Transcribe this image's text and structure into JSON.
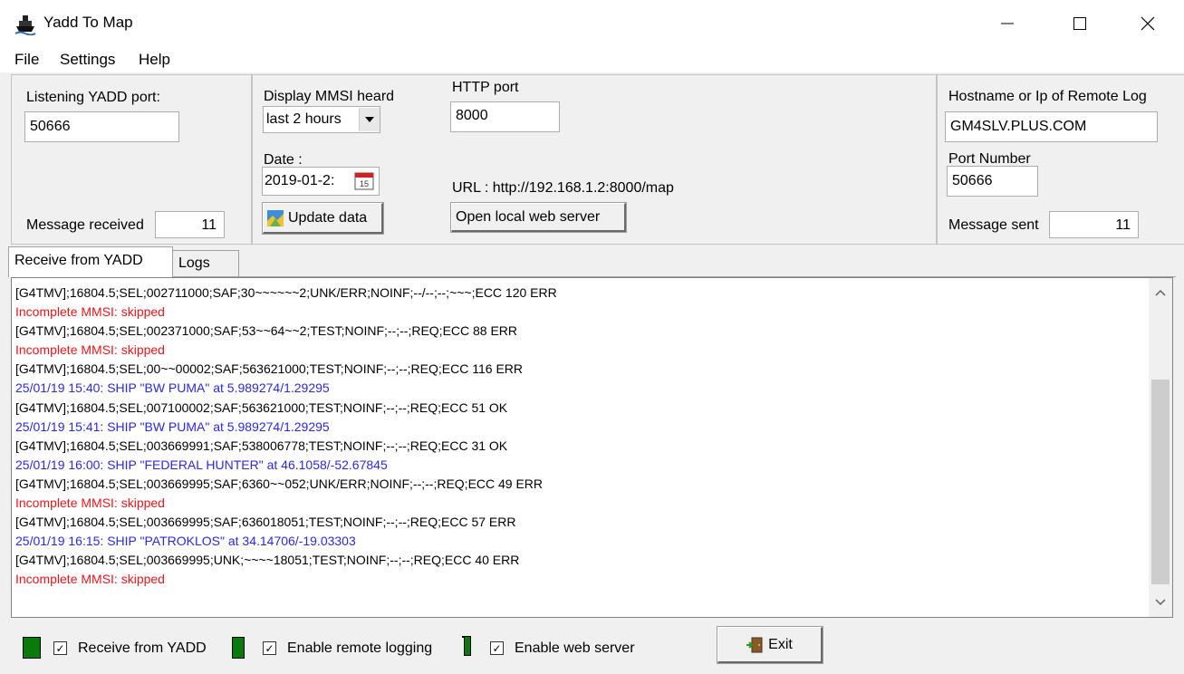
{
  "window": {
    "title": "Yadd To Map"
  },
  "menu": {
    "file": "File",
    "settings": "Settings",
    "help": "Help"
  },
  "yadd": {
    "port_label": "Listening YADD port:",
    "port_value": "50666",
    "msg_label": "Message received",
    "msg_count": "11"
  },
  "display": {
    "mmsi_label": "Display MMSI heard",
    "mmsi_selected": "last 2 hours",
    "date_label": "Date :",
    "date_value": "2019-01-2:",
    "update_label": "Update data"
  },
  "http": {
    "port_label": "HTTP port",
    "port_value": "8000",
    "url_text": "URL : http://192.168.1.2:8000/map",
    "open_label": "Open local web server"
  },
  "remote": {
    "host_label": "Hostname or Ip of Remote Log",
    "host_value": "GM4SLV.PLUS.COM",
    "port_label": "Port Number",
    "port_value": "50666",
    "sent_label": "Message sent",
    "sent_count": "11"
  },
  "tabs": {
    "receive": "Receive from YADD",
    "logs": "Logs"
  },
  "log": [
    {
      "text": "[G4TMV];16804.5;SEL;002711000;SAF;30~~~~~~2;UNK/ERR;NOINF;--/--;--;~~~;ECC 120 ERR",
      "color": "#000000"
    },
    {
      "text": "Incomplete MMSI: skipped",
      "color": "#e8161c"
    },
    {
      "text": "[G4TMV];16804.5;SEL;002371000;SAF;53~~64~~2;TEST;NOINF;--;--;REQ;ECC 88 ERR",
      "color": "#000000"
    },
    {
      "text": "Incomplete MMSI: skipped",
      "color": "#e8161c"
    },
    {
      "text": "[G4TMV];16804.5;SEL;00~~00002;SAF;563621000;TEST;NOINF;--;--;REQ;ECC 116 ERR",
      "color": "#000000"
    },
    {
      "text": "25/01/19 15:40: SHIP \"BW PUMA\" at 5.989274/1.29295",
      "color": "#2a2ae0"
    },
    {
      "text": "[G4TMV];16804.5;SEL;007100002;SAF;563621000;TEST;NOINF;--;--;REQ;ECC 51 OK",
      "color": "#000000"
    },
    {
      "text": "25/01/19 15:41: SHIP \"BW PUMA\" at 5.989274/1.29295",
      "color": "#2a2ae0"
    },
    {
      "text": "[G4TMV];16804.5;SEL;003669991;SAF;538006778;TEST;NOINF;--;--;REQ;ECC 31 OK",
      "color": "#000000"
    },
    {
      "text": "25/01/19 16:00: SHIP \"FEDERAL HUNTER\" at 46.1058/-52.67845",
      "color": "#2a2ae0"
    },
    {
      "text": "[G4TMV];16804.5;SEL;003669995;SAF;6360~~052;UNK/ERR;NOINF;--;--;REQ;ECC 49 ERR",
      "color": "#000000"
    },
    {
      "text": "Incomplete MMSI: skipped",
      "color": "#e8161c"
    },
    {
      "text": "[G4TMV];16804.5;SEL;003669995;SAF;636018051;TEST;NOINF;--;--;REQ;ECC 57 ERR",
      "color": "#000000"
    },
    {
      "text": "25/01/19 16:15: SHIP \"PATROKLOS\" at 34.14706/-19.03303",
      "color": "#2a2ae0"
    },
    {
      "text": "[G4TMV];16804.5;SEL;003669995;UNK;~~~~18051;TEST;NOINF;--;--;REQ;ECC 40 ERR",
      "color": "#000000"
    },
    {
      "text": "Incomplete MMSI: skipped",
      "color": "#e8161c"
    }
  ],
  "bottom": {
    "receive_label": "Receive from YADD",
    "remote_label": "Enable remote logging",
    "web_label": "Enable web server",
    "exit_label": "Exit",
    "receive_checked": true,
    "remote_checked": true,
    "web_checked": true
  },
  "colors": {
    "status_green": "#0a7a0a",
    "error_red": "#e8161c",
    "info_blue": "#2a2ae0"
  },
  "icons": {
    "app": "ship-icon",
    "minimize": "minimize-icon",
    "maximize": "maximize-icon",
    "close": "close-icon",
    "calendar": "calendar-icon",
    "update": "map-icon",
    "exit": "exit-door-icon",
    "scroll_up": "chevron-up-icon",
    "scroll_down": "chevron-down-icon"
  }
}
